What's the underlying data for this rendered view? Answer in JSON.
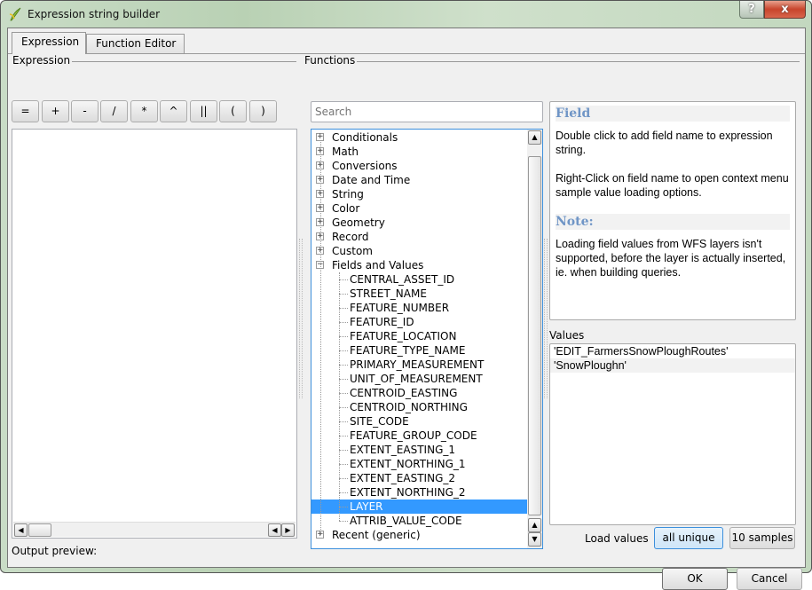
{
  "window": {
    "title": "Expression string builder",
    "help_label": "?",
    "close_label": "x",
    "app_icon": "qgis-icon"
  },
  "tabs": [
    {
      "label": "Expression",
      "active": true
    },
    {
      "label": "Function Editor",
      "active": false
    }
  ],
  "expression": {
    "group_label": "Expression",
    "operators": [
      "=",
      "+",
      "-",
      "/",
      "*",
      "^",
      "||",
      "(",
      ")"
    ],
    "text": "",
    "output_preview_label": "Output preview:"
  },
  "functions": {
    "group_label": "Functions",
    "search_placeholder": "Search",
    "groups_before": [
      "Conditionals",
      "Math",
      "Conversions",
      "Date and Time",
      "String",
      "Color",
      "Geometry",
      "Record",
      "Custom"
    ],
    "expanded_group": "Fields and Values",
    "fields": [
      "CENTRAL_ASSET_ID",
      "STREET_NAME",
      "FEATURE_NUMBER",
      "FEATURE_ID",
      "FEATURE_LOCATION",
      "FEATURE_TYPE_NAME",
      "PRIMARY_MEASUREMENT",
      "UNIT_OF_MEASUREMENT",
      "CENTROID_EASTING",
      "CENTROID_NORTHING",
      "SITE_CODE",
      "FEATURE_GROUP_CODE",
      "EXTENT_EASTING_1",
      "EXTENT_NORTHING_1",
      "EXTENT_EASTING_2",
      "EXTENT_NORTHING_2",
      "LAYER",
      "ATTRIB_VALUE_CODE"
    ],
    "selected_field": "LAYER",
    "groups_after": [
      "Recent (generic)"
    ]
  },
  "help": {
    "title": "Field",
    "para1": "Double click to add field name to expression string.",
    "para2": "Right-Click on field name to open context menu sample value loading options.",
    "note_title": "Note:",
    "note_text": "Loading field values from WFS layers isn't supported, before the layer is actually inserted, ie. when building queries."
  },
  "values": {
    "label": "Values",
    "items": [
      "'EDIT_FarmersSnowPloughRoutes'",
      "'SnowPloughn'"
    ],
    "load_label": "Load values",
    "all_unique_label": "all unique",
    "samples_label": "10 samples"
  },
  "dialog": {
    "ok_label": "OK",
    "cancel_label": "Cancel"
  }
}
